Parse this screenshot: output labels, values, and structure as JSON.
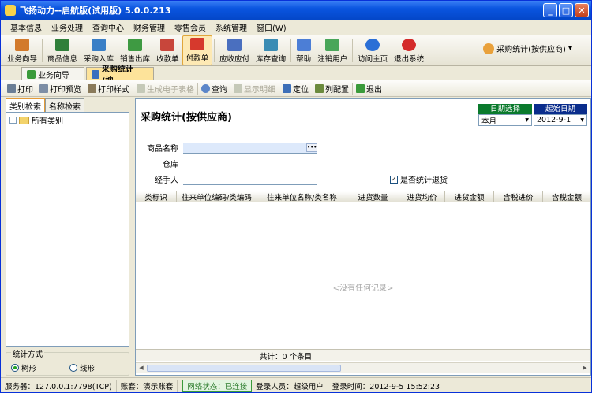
{
  "app": {
    "title": "飞扬动力--启航版(试用版)   5.0.0.213"
  },
  "window_buttons": {
    "min": "_",
    "max": "□",
    "close": "✕"
  },
  "menu": [
    "基本信息",
    "业务处理",
    "查询中心",
    "财务管理",
    "零售会员",
    "系统管理",
    "窗口(W)"
  ],
  "toolbar": [
    {
      "label": "业务向导",
      "icon": "guide-book-icon",
      "color": "#d27a2c"
    },
    {
      "label": "商品信息",
      "icon": "product-grid-icon",
      "color": "#2f7f3a"
    },
    {
      "label": "采购入库",
      "icon": "purchase-in-icon",
      "color": "#3a7fc6"
    },
    {
      "label": "销售出库",
      "icon": "sales-out-icon",
      "color": "#3e9a42"
    },
    {
      "label": "收款单",
      "icon": "receipt-icon",
      "color": "#c8463b"
    },
    {
      "label": "付款单",
      "icon": "payment-icon",
      "color": "#d6392d"
    },
    {
      "label": "应收应付",
      "icon": "ledger-icon",
      "color": "#4a6fbf"
    },
    {
      "label": "库存查询",
      "icon": "inventory-icon",
      "color": "#3b8cb4"
    },
    {
      "label": "帮助",
      "icon": "help-icon",
      "color": "#4c7ed6"
    },
    {
      "label": "注销用户",
      "icon": "logout-user-icon",
      "color": "#49a65a"
    },
    {
      "label": "访问主页",
      "icon": "browser-icon",
      "color": "#2b6fd6"
    },
    {
      "label": "退出系统",
      "icon": "power-icon",
      "color": "#d42b2b"
    }
  ],
  "purchase_stat_menu": {
    "label": "采购统计(按供应商)",
    "arrow": "▾"
  },
  "tabs": [
    {
      "label": "业务向导",
      "active": false
    },
    {
      "label": "采购统计(按...",
      "active": true
    }
  ],
  "subtoolbar": [
    {
      "label": "打印",
      "disabled": false
    },
    {
      "label": "打印预览",
      "disabled": false
    },
    {
      "label": "打印样式",
      "disabled": false
    },
    {
      "label": "生成电子表格",
      "disabled": true
    },
    {
      "label": "查询",
      "disabled": false
    },
    {
      "label": "显示明细",
      "disabled": true
    },
    {
      "label": "定位",
      "disabled": false
    },
    {
      "label": "列配置",
      "disabled": false
    },
    {
      "label": "退出",
      "disabled": false
    }
  ],
  "left": {
    "tabs": [
      "类别检索",
      "名称检索"
    ],
    "tree_root": "所有类别",
    "stat_group_title": "统计方式",
    "radio_tree": "树形",
    "radio_line": "线形"
  },
  "report": {
    "title": "采购统计(按供应商)",
    "date_select_label": "日期选择",
    "date_select_value": "本月",
    "start_date_label": "起始日期",
    "start_date_value": "2012-9-1",
    "field_product": "商品名称",
    "field_warehouse": "仓库",
    "field_handler": "经手人",
    "include_return_label": "是否统计退货",
    "include_return_checked": true
  },
  "grid": {
    "columns": [
      "类标识",
      "往来单位编码/类编码",
      "往来单位名称/类名称",
      "进货数量",
      "进货均价",
      "进货金额",
      "含税进价",
      "含税金额"
    ],
    "empty_text": "<没有任何记录>",
    "footer_total": "共计：0 个条目"
  },
  "status": {
    "server": "服务器：127.0.0.1:7798(TCP)",
    "account": "账套：演示账套",
    "network": "网络状态：已连接",
    "user": "登录人员：超级用户",
    "login_time": "登录时间：2012-9-5 15:52:23"
  }
}
